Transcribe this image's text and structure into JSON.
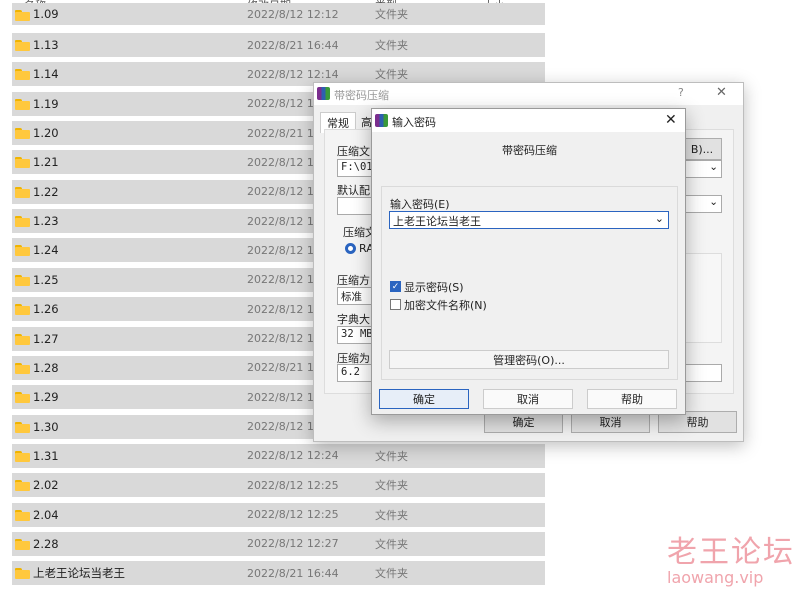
{
  "columns": {
    "name": "名称",
    "date": "修改日期",
    "type": "类型",
    "size": "大小"
  },
  "rows": [
    {
      "name": "1.09",
      "date": "2022/8/12 12:12",
      "type": "文件夹"
    },
    {
      "name": "1.13",
      "date": "2022/8/21 16:44",
      "type": "文件夹"
    },
    {
      "name": "1.14",
      "date": "2022/8/12 12:14",
      "type": "文件夹"
    },
    {
      "name": "1.19",
      "date": "2022/8/12 12:15",
      "type": ""
    },
    {
      "name": "1.20",
      "date": "2022/8/21 16",
      "type": ""
    },
    {
      "name": "1.21",
      "date": "2022/8/12 12",
      "type": ""
    },
    {
      "name": "1.22",
      "date": "2022/8/12 12",
      "type": ""
    },
    {
      "name": "1.23",
      "date": "2022/8/12 12",
      "type": ""
    },
    {
      "name": "1.24",
      "date": "2022/8/12 12",
      "type": ""
    },
    {
      "name": "1.25",
      "date": "2022/8/12 12",
      "type": ""
    },
    {
      "name": "1.26",
      "date": "2022/8/12 12",
      "type": ""
    },
    {
      "name": "1.27",
      "date": "2022/8/12 12",
      "type": ""
    },
    {
      "name": "1.28",
      "date": "2022/8/21 16",
      "type": ""
    },
    {
      "name": "1.29",
      "date": "2022/8/12 12",
      "type": ""
    },
    {
      "name": "1.30",
      "date": "2022/8/12 12",
      "type": ""
    },
    {
      "name": "1.31",
      "date": "2022/8/12 12:24",
      "type": "文件夹"
    },
    {
      "name": "2.02",
      "date": "2022/8/12 12:25",
      "type": "文件夹"
    },
    {
      "name": "2.04",
      "date": "2022/8/12 12:25",
      "type": "文件夹"
    },
    {
      "name": "2.28",
      "date": "2022/8/12 12:27",
      "type": "文件夹"
    },
    {
      "name": "上老王论坛当老王",
      "date": "2022/8/21 16:44",
      "type": "文件夹"
    }
  ],
  "archive_dialog": {
    "title": "带密码压缩",
    "help_glyph": "?",
    "close_glyph": "✕",
    "tab_general": "常规",
    "tab_advanced": "高",
    "archive_name_label": "压缩文",
    "archive_path": "F:\\010",
    "default_profile_label": "默认配",
    "archive_format_label": "压缩文",
    "format_rar": "RA",
    "method_label": "压缩方",
    "method_value": "标准",
    "dict_label": "字典大",
    "dict_value": "32 MB",
    "split_label": "压缩为",
    "split_value": "6.2",
    "browse_button": "B)...",
    "ok": "确定",
    "cancel": "取消",
    "help": "帮助"
  },
  "password_dialog": {
    "title": "输入密码",
    "close_glyph": "✕",
    "heading": "带密码压缩",
    "password_label": "输入密码(E)",
    "password_value": "上老王论坛当老王",
    "show_password": "显示密码(S)",
    "encrypt_names": "加密文件名称(N)",
    "manage_button": "管理密码(O)...",
    "ok": "确定",
    "cancel": "取消",
    "help": "帮助"
  },
  "watermark": {
    "cn": "老王论坛",
    "url": "laowang.vip"
  }
}
